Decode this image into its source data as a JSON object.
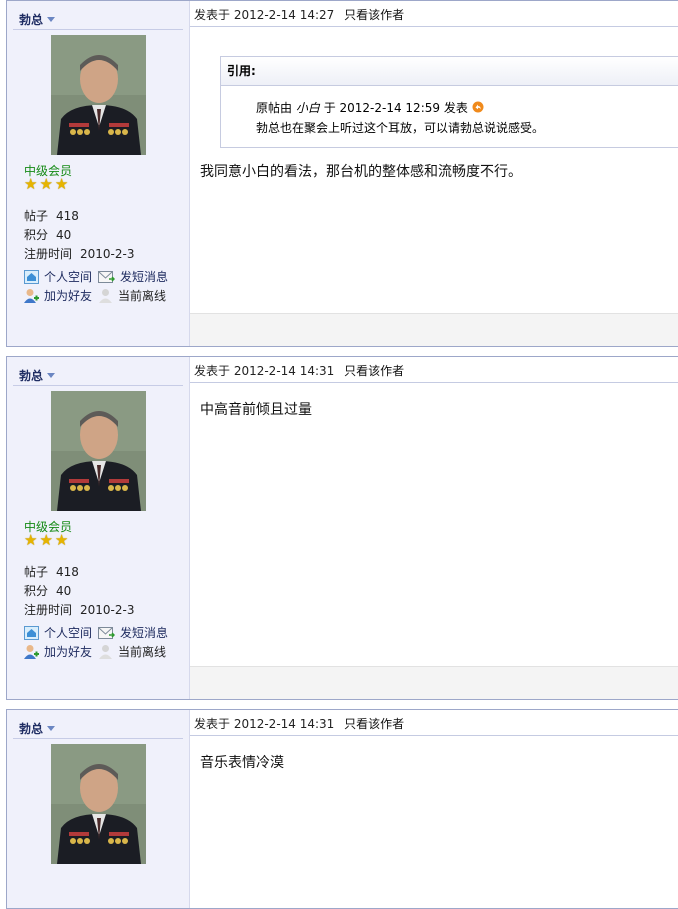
{
  "posts": [
    {
      "author": "勃总",
      "rank": "中级会员",
      "stats": {
        "posts_label": "帖子",
        "posts_value": "418",
        "points_label": "积分",
        "points_value": "40",
        "reg_label": "注册时间",
        "reg_value": "2010-2-3"
      },
      "actions": {
        "space": "个人空间",
        "message": "发短消息",
        "friend": "加为好友",
        "status": "当前离线"
      },
      "posted": "发表于 2012-2-14 14:27",
      "only_author": "只看该作者",
      "quote": {
        "title": "引用:",
        "prefix": "原帖由",
        "name": "小白",
        "suffix": "于 2012-2-14 12:59 发表",
        "text": "勃总也在聚会上听过这个耳放，可以请勃总说说感受。"
      },
      "body": "我同意小白的看法，那台机的整体感和流畅度不行。"
    },
    {
      "author": "勃总",
      "rank": "中级会员",
      "stats": {
        "posts_label": "帖子",
        "posts_value": "418",
        "points_label": "积分",
        "points_value": "40",
        "reg_label": "注册时间",
        "reg_value": "2010-2-3"
      },
      "actions": {
        "space": "个人空间",
        "message": "发短消息",
        "friend": "加为好友",
        "status": "当前离线"
      },
      "posted": "发表于 2012-2-14 14:31",
      "only_author": "只看该作者",
      "body": "中高音前倾且过量"
    },
    {
      "author": "勃总",
      "posted": "发表于 2012-2-14 14:31",
      "only_author": "只看该作者",
      "body": "音乐表情冷漠"
    }
  ],
  "colors": {
    "accent": "#1f2d63",
    "rank": "#158a15",
    "sidebar": "#f0f1fb",
    "border": "#9da7c9"
  }
}
